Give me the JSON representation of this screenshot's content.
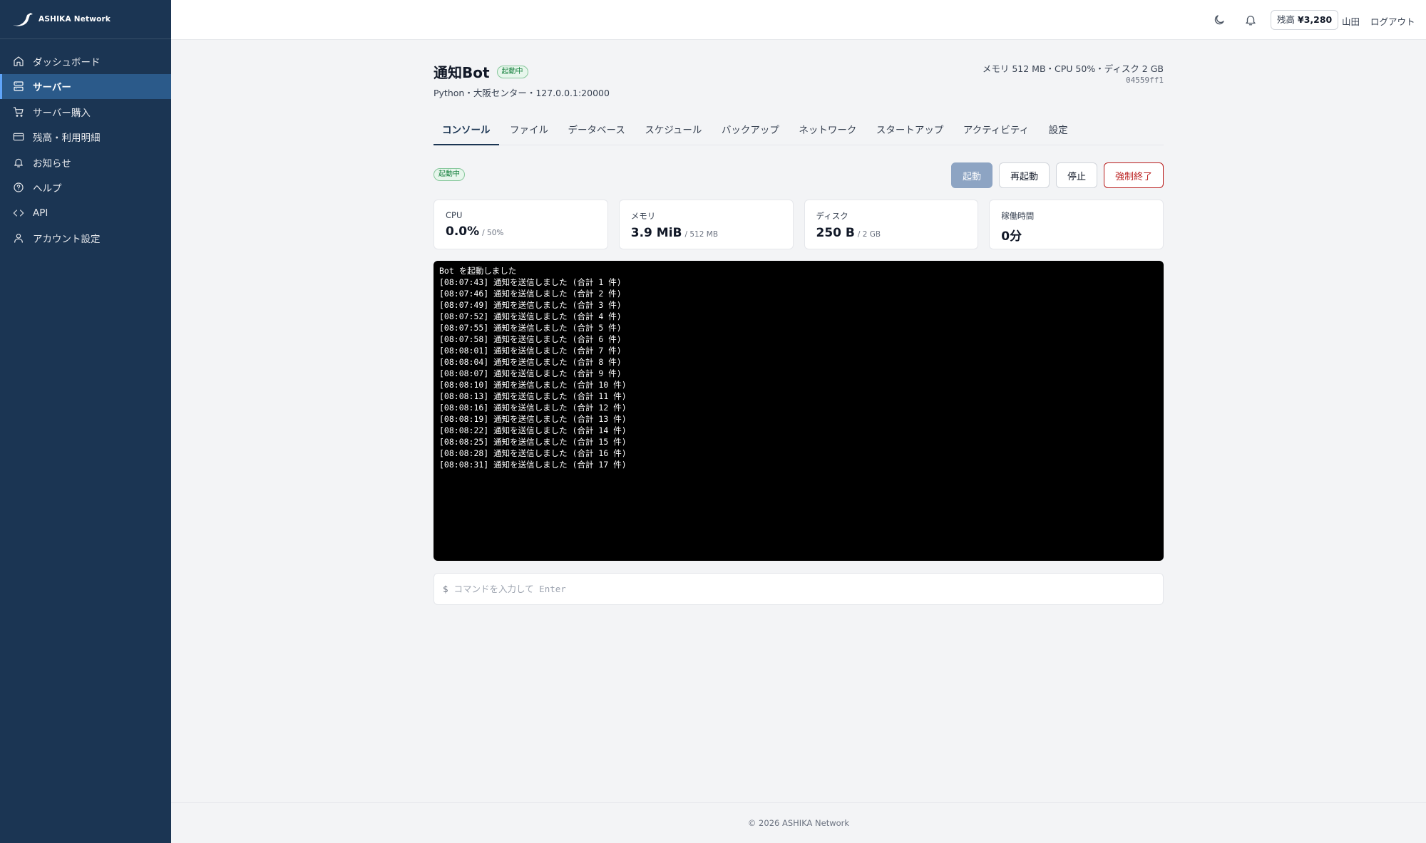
{
  "brand": {
    "name": "ASHIKA Network",
    "logo_icon": "bird-logo-icon"
  },
  "sidebar": {
    "items": [
      {
        "label": "ダッシュボード",
        "icon": "home-icon",
        "active": false
      },
      {
        "label": "サーバー",
        "icon": "server-icon",
        "active": true
      },
      {
        "label": "サーバー購入",
        "icon": "cart-icon",
        "active": false
      },
      {
        "label": "残高・利用明細",
        "icon": "credit-card-icon",
        "active": false
      },
      {
        "label": "お知らせ",
        "icon": "bell-icon",
        "active": false
      },
      {
        "label": "ヘルプ",
        "icon": "help-circle-icon",
        "active": false
      },
      {
        "label": "API",
        "icon": "code-icon",
        "active": false
      },
      {
        "label": "アカウント設定",
        "icon": "user-icon",
        "active": false
      }
    ]
  },
  "topbar": {
    "balance_label": "残高",
    "balance_value": "¥3,280",
    "user_name": "山田",
    "logout_label": "ログアウト"
  },
  "server": {
    "name": "通知Bot",
    "status": "起動中",
    "subtitle": "Python・大阪センター・127.0.0.1:20000",
    "spec": "メモリ 512 MB・CPU 50%・ディスク 2 GB",
    "id": "04559ff1"
  },
  "tabs": [
    {
      "label": "コンソール",
      "active": true
    },
    {
      "label": "ファイル",
      "active": false
    },
    {
      "label": "データベース",
      "active": false
    },
    {
      "label": "スケジュール",
      "active": false
    },
    {
      "label": "バックアップ",
      "active": false
    },
    {
      "label": "ネットワーク",
      "active": false
    },
    {
      "label": "スタートアップ",
      "active": false
    },
    {
      "label": "アクティビティ",
      "active": false
    },
    {
      "label": "設定",
      "active": false
    }
  ],
  "controls": {
    "status": "起動中",
    "start_label": "起動",
    "restart_label": "再起動",
    "stop_label": "停止",
    "kill_label": "強制終了"
  },
  "stats": [
    {
      "label": "CPU",
      "value": "0.0%",
      "limit": "/ 50%"
    },
    {
      "label": "メモリ",
      "value": "3.9 MiB",
      "limit": "/ 512 MB"
    },
    {
      "label": "ディスク",
      "value": "250 B",
      "limit": "/ 2 GB"
    },
    {
      "label": "稼働時間",
      "value": "0分",
      "limit": ""
    }
  ],
  "console": {
    "lines": [
      "Bot を起動しました",
      "[08:07:43] 通知を送信しました (合計 1 件)",
      "[08:07:46] 通知を送信しました (合計 2 件)",
      "[08:07:49] 通知を送信しました (合計 3 件)",
      "[08:07:52] 通知を送信しました (合計 4 件)",
      "[08:07:55] 通知を送信しました (合計 5 件)",
      "[08:07:58] 通知を送信しました (合計 6 件)",
      "[08:08:01] 通知を送信しました (合計 7 件)",
      "[08:08:04] 通知を送信しました (合計 8 件)",
      "[08:08:07] 通知を送信しました (合計 9 件)",
      "[08:08:10] 通知を送信しました (合計 10 件)",
      "[08:08:13] 通知を送信しました (合計 11 件)",
      "[08:08:16] 通知を送信しました (合計 12 件)",
      "[08:08:19] 通知を送信しました (合計 13 件)",
      "[08:08:22] 通知を送信しました (合計 14 件)",
      "[08:08:25] 通知を送信しました (合計 15 件)",
      "[08:08:28] 通知を送信しました (合計 16 件)",
      "[08:08:31] 通知を送信しました (合計 17 件)"
    ]
  },
  "command": {
    "prompt": "$",
    "placeholder": "コマンドを入力して Enter",
    "value": ""
  },
  "footer": {
    "text": "© 2026 ASHIKA Network"
  },
  "colors": {
    "sidebar_bg": "#1b3553",
    "sidebar_active": "#2b5a8a",
    "status_green": "#15803d",
    "danger": "#b91c1c",
    "start_button": "#8da4c3"
  }
}
